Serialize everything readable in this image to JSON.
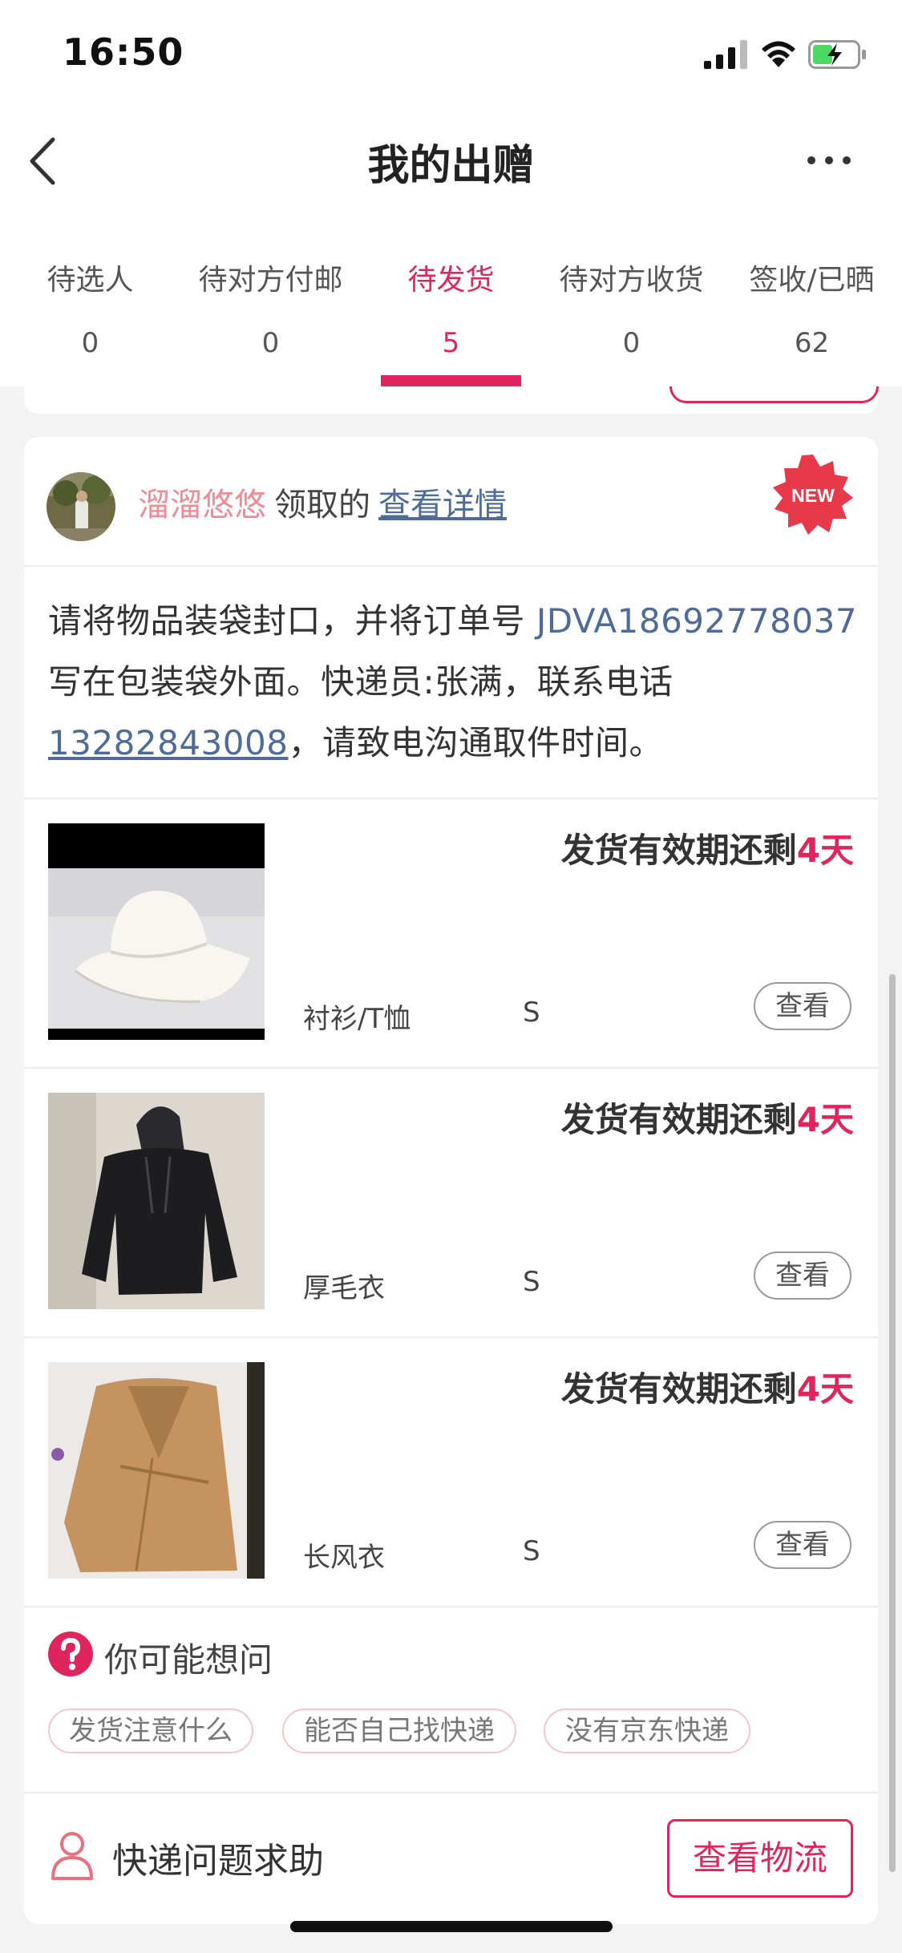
{
  "status_bar": {
    "time": "16:50"
  },
  "nav": {
    "title": "我的出赠"
  },
  "tabs": [
    {
      "label": "待选人",
      "count": "0",
      "active": false
    },
    {
      "label": "待对方付邮",
      "count": "0",
      "active": false
    },
    {
      "label": "待发货",
      "count": "5",
      "active": true
    },
    {
      "label": "待对方收货",
      "count": "0",
      "active": false
    },
    {
      "label": "签收/已晒",
      "count": "62",
      "active": false
    }
  ],
  "order": {
    "user_name": "溜溜悠悠",
    "action_text": "领取的",
    "detail_link": "查看详情",
    "badge": "NEW",
    "instruction": {
      "p1": "请将物品装袋封口，并将订单号 ",
      "order_no": "JDVA18692778037",
      "p2": " 写在包装袋外面。快递员:张满，联系电话",
      "phone": "13282843008",
      "p3": "，请致电沟通取件时间。"
    },
    "items": [
      {
        "deadline_prefix": "发货有效期还剩",
        "days": "4天",
        "category": "衬衫/T恤",
        "size": "S",
        "view_label": "查看",
        "image_icon": "hat-photo"
      },
      {
        "deadline_prefix": "发货有效期还剩",
        "days": "4天",
        "category": "厚毛衣",
        "size": "S",
        "view_label": "查看",
        "image_icon": "black-hoodie-photo"
      },
      {
        "deadline_prefix": "发货有效期还剩",
        "days": "4天",
        "category": "长风衣",
        "size": "S",
        "view_label": "查看",
        "image_icon": "trench-coat-photo"
      }
    ],
    "faq": {
      "title": "你可能想问",
      "chips": [
        "发货注意什么",
        "能否自己找快递",
        "没有京东快递"
      ]
    },
    "help": {
      "label": "快递问题求助",
      "logistics_button": "查看物流"
    }
  },
  "colors": {
    "accent": "#e0245e",
    "link": "#4f6b97",
    "username": "#ef8a96"
  }
}
